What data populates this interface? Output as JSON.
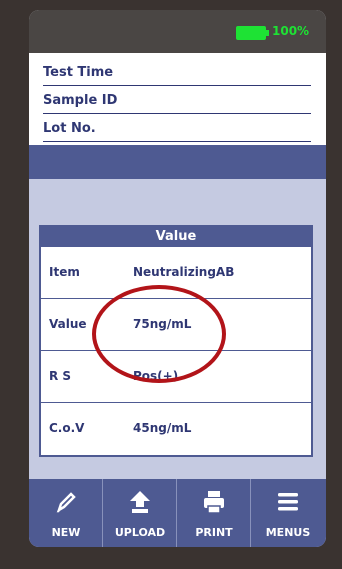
{
  "status": {
    "battery_percent": "100%",
    "battery_color": "#1ee234"
  },
  "info": {
    "rows": [
      {
        "label": "Test Time"
      },
      {
        "label": "Sample ID"
      },
      {
        "label": "Lot No."
      }
    ]
  },
  "value_table": {
    "header": "Value",
    "rows": [
      {
        "label": "Item",
        "value": "NeutralizingAB"
      },
      {
        "label": "Value",
        "value": "75ng/mL"
      },
      {
        "label": "R S",
        "value": "Pos(+)"
      },
      {
        "label": "C.o.V",
        "value": "45ng/mL"
      }
    ]
  },
  "toolbar": {
    "buttons": [
      {
        "label": "NEW",
        "icon": "pencil-icon"
      },
      {
        "label": "UPLOAD",
        "icon": "upload-icon"
      },
      {
        "label": "PRINT",
        "icon": "printer-icon"
      },
      {
        "label": "MENUS",
        "icon": "menu-icon"
      }
    ]
  },
  "colors": {
    "primary": "#4e5a92",
    "text": "#2f3773",
    "highlight_circle": "#b21419"
  }
}
